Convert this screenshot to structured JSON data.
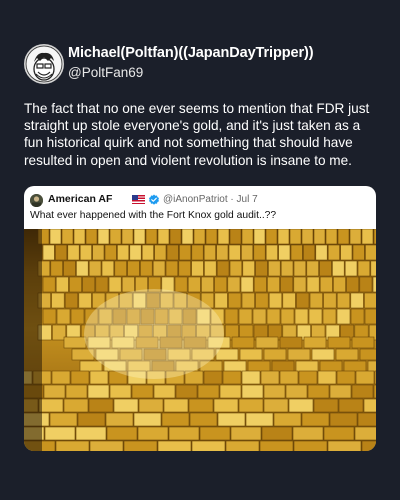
{
  "author": {
    "display_name": "Michael(Poltfan)((JapanDayTripper))",
    "handle": "@PoltFan69"
  },
  "post": {
    "text": "The fact that no one ever seems to mention that FDR just straight up stole everyone's gold, and it's just taken as a fun historical quirk and not something that should have resulted in open and violent revolution is insane to me."
  },
  "quote": {
    "name": "American AF",
    "handle_and_time": "@iAnonPatriot · Jul 7",
    "text": "What ever happened with the Fort Knox gold audit..??"
  },
  "colors": {
    "background": "#1b1f2a",
    "text": "#ffffff",
    "verified": "#1d9bf0",
    "gold": "#c4911f"
  },
  "icons": {
    "verified": "verified-badge-icon",
    "flag": "us-flag-icon"
  }
}
